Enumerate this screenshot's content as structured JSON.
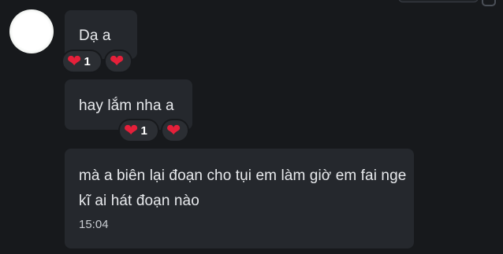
{
  "messages": [
    {
      "text": "Dạ a",
      "reactions": [
        {
          "emoji": "❤",
          "icon": "heart-icon",
          "count": "1"
        },
        {
          "emoji": "❤",
          "icon": "heart-icon"
        }
      ]
    },
    {
      "text": "hay lắm nha a",
      "reactions": [
        {
          "emoji": "❤",
          "icon": "heart-icon",
          "count": "1"
        },
        {
          "emoji": "❤",
          "icon": "heart-icon"
        }
      ]
    },
    {
      "text": "mà a biên lại đoạn cho tụi em làm giờ em fai nge kĩ ai hát đoạn nào",
      "time": "15:04"
    }
  ],
  "colors": {
    "background": "#17191c",
    "bubble": "#25282d",
    "heart": "#e5203a"
  }
}
